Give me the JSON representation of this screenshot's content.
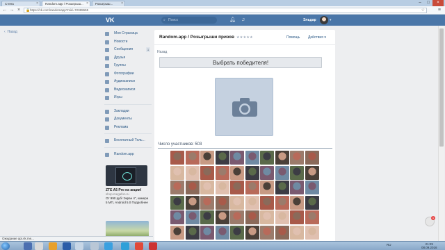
{
  "browser": {
    "tabs": [
      {
        "label": "Стена",
        "active": false
      },
      {
        "label": "Random.app / Розыгрыш...",
        "active": true
      },
      {
        "label": "Розыгрыш...",
        "active": false
      }
    ],
    "url": "https://vk.com/randomapp?mid=72365555",
    "status": "Ожидание api.vk.me..."
  },
  "vk": {
    "logo": "VK",
    "search_placeholder": "Поиск",
    "user_name": "Эльдар",
    "back_label": "Назад"
  },
  "sidebar": {
    "items": [
      {
        "label": "Моя Страница",
        "icon": "home-icon",
        "count": ""
      },
      {
        "label": "Новости",
        "icon": "news-icon",
        "count": ""
      },
      {
        "label": "Сообщения",
        "icon": "message-icon",
        "count": "1"
      },
      {
        "label": "Друзья",
        "icon": "friends-icon",
        "count": ""
      },
      {
        "label": "Группы",
        "icon": "groups-icon",
        "count": ""
      },
      {
        "label": "Фотографии",
        "icon": "photo-icon",
        "count": ""
      },
      {
        "label": "Аудиозаписи",
        "icon": "music-icon",
        "count": ""
      },
      {
        "label": "Видеозаписи",
        "icon": "video-icon",
        "count": ""
      },
      {
        "label": "Игры",
        "icon": "games-icon",
        "count": ""
      }
    ],
    "items2": [
      {
        "label": "Закладки",
        "icon": "bookmark-icon"
      },
      {
        "label": "Документы",
        "icon": "document-icon"
      },
      {
        "label": "Реклама",
        "icon": "ads-icon"
      }
    ],
    "items3": [
      {
        "label": "Бесплатный Тель...",
        "icon": "phone-icon"
      }
    ],
    "items4": [
      {
        "label": "Random.app",
        "icon": "app-icon"
      }
    ],
    "ad": {
      "title": "ZTE A5 Pro на акции!",
      "domain": "shop.megafon.ru",
      "text": "От 990 руб! Экран 4\", камера 5 МП, Android 5.0 Подробнее"
    }
  },
  "app": {
    "title": "Random.app / Розыгрыши призов",
    "rating": "★★★★★",
    "help": "Помощь",
    "actions": "Действия",
    "back": "Назад",
    "pick_button": "Выбрать победителя!",
    "participants": "Число участников: 503"
  },
  "taskbar": {
    "lang": "RU",
    "time": "21:29",
    "date": "08.09.2016"
  }
}
